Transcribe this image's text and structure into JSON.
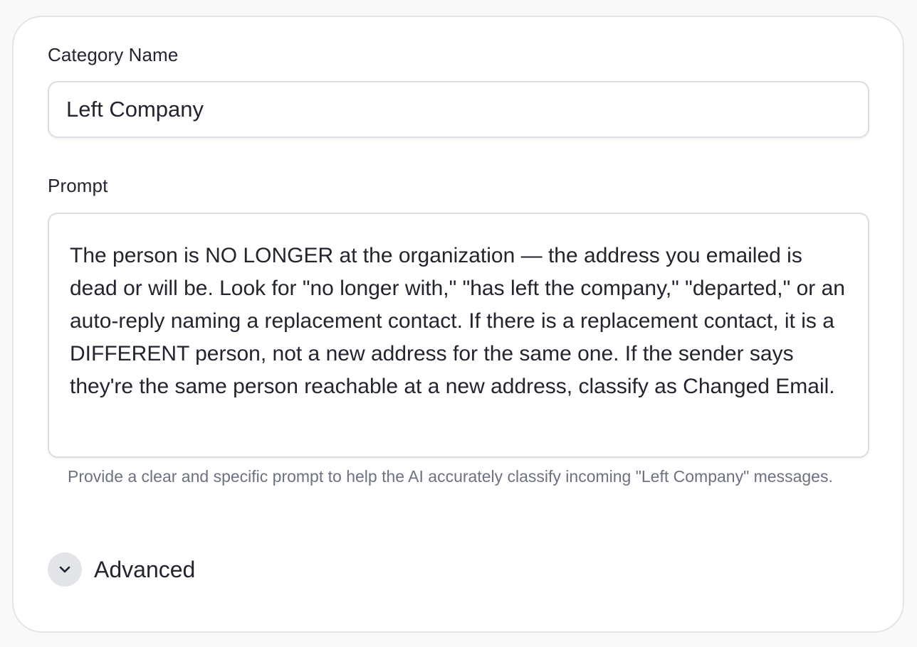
{
  "form": {
    "category_name": {
      "label": "Category Name",
      "value": "Left Company"
    },
    "prompt": {
      "label": "Prompt",
      "value": "The person is NO LONGER at the organization — the address you emailed is dead or will be. Look for \"no longer with,\" \"has left the company,\" \"departed,\" or an auto-reply naming a replacement contact. If there is a replacement contact, it is a DIFFERENT person, not a new address for the same one. If the sender says they're the same person reachable at a new address, classify as Changed Email.",
      "helper": "Provide a clear and specific prompt to help the AI accurately classify incoming \"Left Company\" messages."
    },
    "advanced": {
      "label": "Advanced",
      "icon": "chevron-down-icon"
    }
  }
}
